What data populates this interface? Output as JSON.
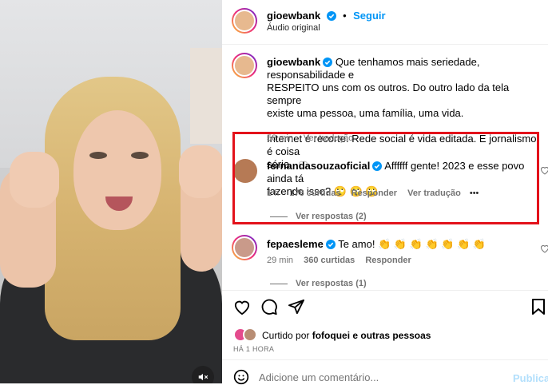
{
  "post": {
    "author": "gioewbank",
    "follow_label": "Seguir",
    "audio_label": "Áudio original",
    "caption_lines": [
      "Que tenhamos mais seriedade, responsabilidade e",
      "RESPEITO uns com os outros. Do outro lado da tela sempre",
      "existe uma pessoa, uma família, uma vida."
    ],
    "caption_lines2": [
      "Internet é recorte. Rede social é vida editada. E jornalismo é coisa",
      "séria."
    ],
    "caption_time": "58 min",
    "translate_label": "Ver tradução"
  },
  "comments": [
    {
      "author": "fernandasouzaoficial",
      "text_line1": "Affffff gente! 2023 e esse povo ainda tá",
      "text_line2": "fazendo isso? 🙄 🙄 🙄",
      "time": "1 h",
      "likes": "176 curtidas",
      "reply_label": "Responder",
      "translate_label": "Ver tradução",
      "more": "•••",
      "view_replies": "Ver respostas (2)"
    },
    {
      "author": "fepaesleme",
      "text": "Te amo! 👏 👏 👏 👏 👏 👏 👏",
      "time": "29 min",
      "likes": "360 curtidas",
      "reply_label": "Responder",
      "view_replies": "Ver respostas (1)"
    }
  ],
  "likes_bar": {
    "liked_by_prefix": "Curtido por",
    "liked_by_user": "fofoquei",
    "liked_by_suffix": "e outras pessoas",
    "timestamp": "HÁ 1 HORA"
  },
  "comment_box": {
    "placeholder": "Adicione um comentário...",
    "post_label": "Publicar"
  },
  "icons": [
    "verified-badge",
    "heart-icon",
    "comment-icon",
    "share-icon",
    "bookmark-icon",
    "emoji-icon",
    "mute-icon"
  ],
  "colors": {
    "accent": "#0095f6",
    "highlight": "#e3121b",
    "muted": "#737373"
  }
}
